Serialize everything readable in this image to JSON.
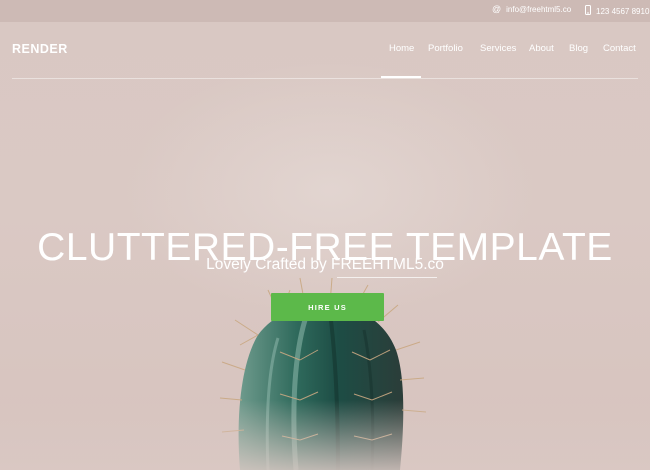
{
  "topbar": {
    "email": "info@freehtml5.co",
    "phone": "123 4567 8910"
  },
  "header": {
    "logo": "RENDER"
  },
  "nav": {
    "items": [
      "Home",
      "Portfolio",
      "Services",
      "About",
      "Blog",
      "Contact"
    ],
    "active": "Home"
  },
  "hero": {
    "title": "CLUTTERED-FREE TEMPLATE",
    "subtitle_prefix": "Lovely Crafted by ",
    "subtitle_link": "FREEHTML5.co",
    "button_label": "HIRE US"
  },
  "colors": {
    "background": "#d9c8c3",
    "button": "#5cb94a",
    "text": "#ffffff"
  }
}
